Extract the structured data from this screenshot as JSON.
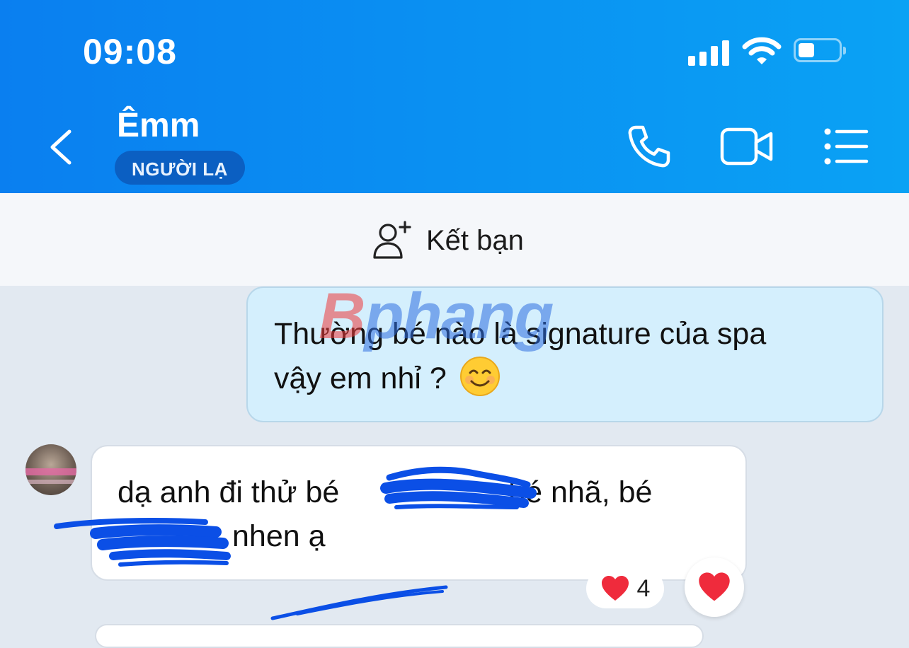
{
  "status_bar": {
    "time": "09:08",
    "battery_level": 0.4,
    "icons": [
      "signal-icon",
      "wifi-icon",
      "battery-icon"
    ]
  },
  "header": {
    "contact_name": "Êmm",
    "badge": "NGƯỜI LẠ",
    "icons": [
      "back-icon",
      "phone-icon",
      "video-call-icon",
      "menu-list-icon"
    ],
    "colors": {
      "gradient_start": "#0a7ff0",
      "gradient_end": "#0aa2f4",
      "badge_bg": "#0b5fc2"
    }
  },
  "add_friend": {
    "label": "Kết bạn",
    "icon": "add-person-icon"
  },
  "messages": [
    {
      "direction": "outgoing",
      "lines": [
        "Thường bé nào là signature của spa",
        "vậy em nhỉ ?"
      ],
      "emoji": "smiling-face-emoji"
    },
    {
      "direction": "incoming",
      "lines": [
        "dạ anh đi thử bé",
        ", bé nhã, bé",
        "nhen ạ"
      ],
      "redacted": true,
      "reaction": {
        "icon": "heart-icon",
        "count": "4"
      }
    }
  ],
  "watermark": {
    "part1": "B",
    "part2": "phang"
  }
}
